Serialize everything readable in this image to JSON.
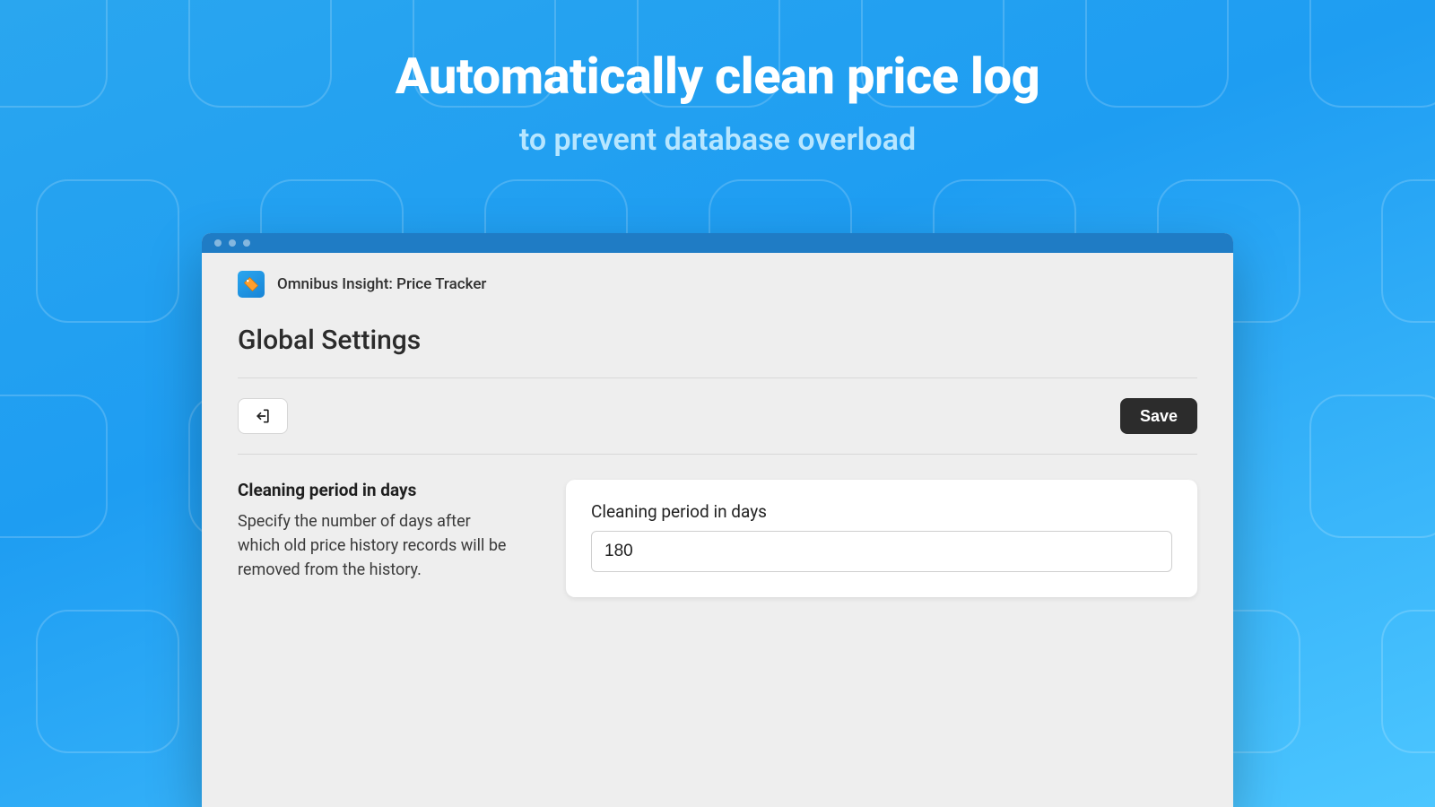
{
  "hero": {
    "title": "Automatically clean price log",
    "subtitle": "to prevent database overload"
  },
  "app": {
    "name": "Omnibus Insight: Price Tracker"
  },
  "page": {
    "title": "Global Settings"
  },
  "toolbar": {
    "save_label": "Save"
  },
  "form": {
    "cleaning_period": {
      "title": "Cleaning period in days",
      "description": "Specify the number of days after which old price history records will be removed from the history.",
      "field_label": "Cleaning period in days",
      "value": "180"
    }
  }
}
